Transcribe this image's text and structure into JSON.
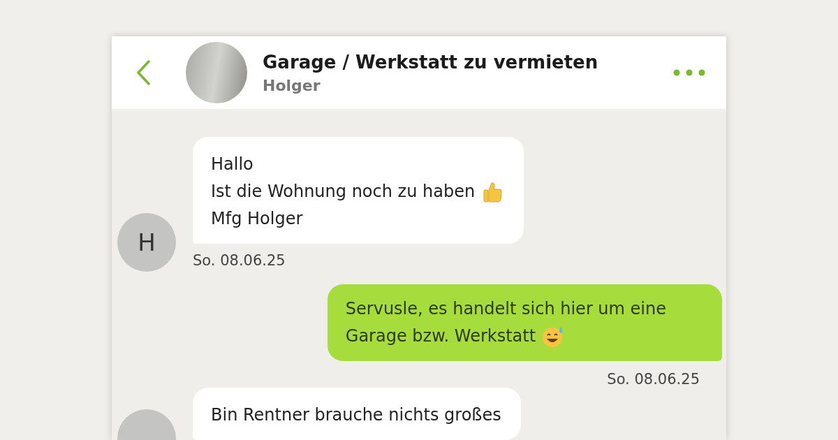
{
  "header": {
    "title": "Garage / Werkstatt zu vermieten",
    "subtitle": "Holger"
  },
  "messages": [
    {
      "kind": "incoming",
      "avatar": "H",
      "lines": [
        {
          "text": "Hallo"
        },
        {
          "text": "Ist die Wohnung noch zu haben",
          "kind": "thumbs_up"
        },
        {
          "text": "Mfg Holger"
        }
      ],
      "time": "So. 08.06.25"
    },
    {
      "kind": "outgoing",
      "lines": [
        {
          "text": "Servusle, es handelt sich hier um eine"
        },
        {
          "text": "Garage bzw. Werkstatt",
          "kind": "sweat_smile"
        }
      ],
      "time": "So. 08.06.25"
    },
    {
      "kind": "incoming",
      "lines": [
        {
          "text": "Bin Rentner brauche nichts großes"
        }
      ]
    }
  ]
}
